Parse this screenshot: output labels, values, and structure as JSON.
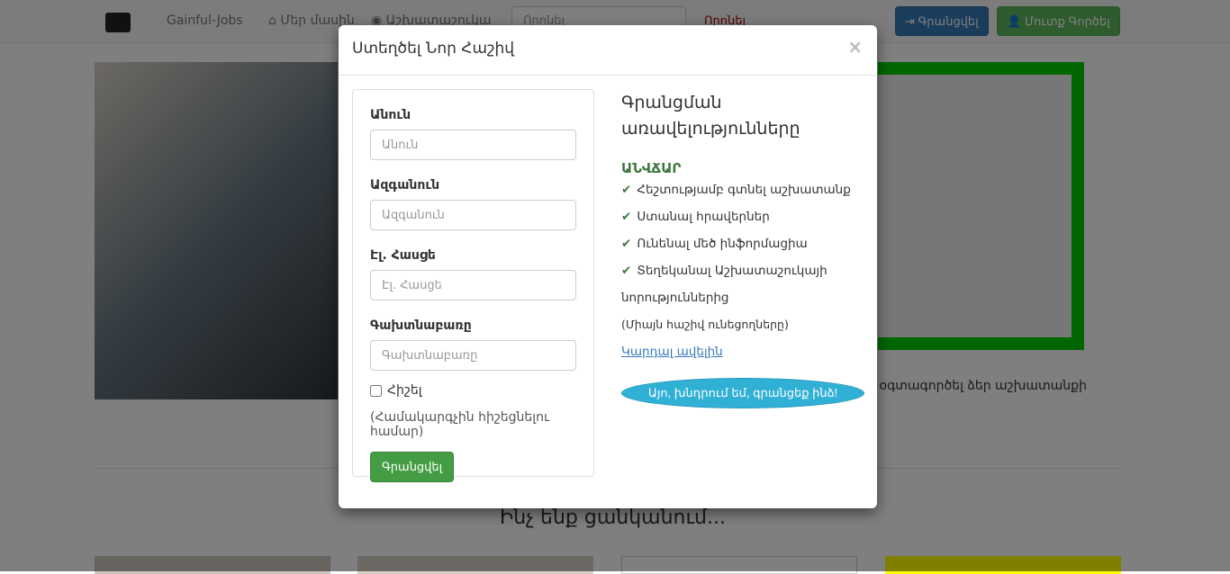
{
  "nav": {
    "brand": "Gainful-Jobs",
    "about": "Մեր մասին",
    "market": "Աշխատաշուկա",
    "search_placeholder": "Որոնել",
    "search_button": "Որոնել",
    "register": "Գրանցվել",
    "login": "Մուտք Գործել"
  },
  "page": {
    "hero_text": "ւ օգտագործել ձեր աշխատանքի",
    "section_title": "Ինչ ենք ցանկանում..."
  },
  "modal": {
    "title": "Ստեղծել Նոր Հաշիվ",
    "close": "×",
    "form": {
      "first_name_label": "Անուն",
      "first_name_placeholder": "Անուն",
      "last_name_label": "Ազգանուն",
      "last_name_placeholder": "Ազգանուն",
      "email_label": "Էլ. Հասցե",
      "email_placeholder": "Էլ. Հասցե",
      "password_label": "Գախտնաբառը",
      "password_placeholder": "Գախտնաբառը",
      "remember": "Հիշել",
      "remember_hint": "(Համակարգչին հիշեցնելու համար)",
      "submit": "Գրանցվել"
    },
    "benefits": {
      "title": "Գրանցման առավելությունները",
      "free": "ԱՆՎՃԱՐ",
      "items": [
        "Հեշտությամբ գտնել աշխատանք",
        "Ստանալ հրավերներ",
        "Ունենալ մեծ ինֆորմացիա",
        "Տեղեկանալ Աշխատաշուկայի"
      ],
      "continuation": "նորություններից",
      "note": "(Միայն հաշիվ ունեցողները)",
      "more_link": "Կարդալ ավելին",
      "cta": "Այո, խնդրում եմ, գրանցեք ինձ!"
    }
  }
}
